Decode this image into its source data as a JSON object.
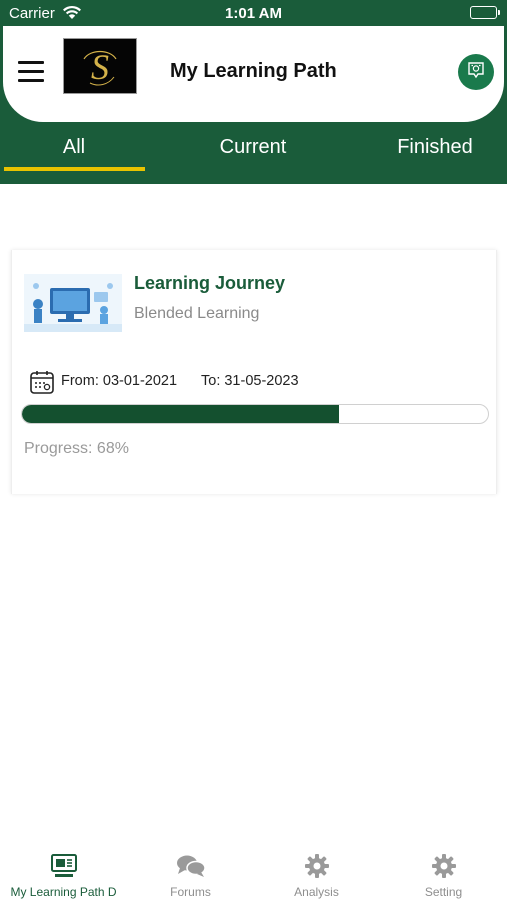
{
  "status_bar": {
    "carrier": "Carrier",
    "time": "1:01 AM"
  },
  "header": {
    "title": "My Learning Path",
    "logo_text": "S"
  },
  "tabs": [
    {
      "label": "All",
      "active": true
    },
    {
      "label": "Current",
      "active": false
    },
    {
      "label": "Finished",
      "active": false
    }
  ],
  "course": {
    "title": "Learning Journey",
    "subtitle": "Blended Learning",
    "from_label": "From: 03-01-2021",
    "to_label": "To: 31-05-2023",
    "progress_percent": 68,
    "progress_label": "Progress: 68%"
  },
  "bottom_nav": [
    {
      "label": "My Learning Path D",
      "icon": "learning-path-icon",
      "active": true
    },
    {
      "label": "Forums",
      "icon": "chat-bubbles-icon",
      "active": false
    },
    {
      "label": "Analysis",
      "icon": "gear-icon",
      "active": false
    },
    {
      "label": "Setting",
      "icon": "gear-icon",
      "active": false
    }
  ],
  "colors": {
    "brand_green": "#1a5c3a",
    "tab_indicator": "#e8c300",
    "progress_fill": "#14502f"
  }
}
